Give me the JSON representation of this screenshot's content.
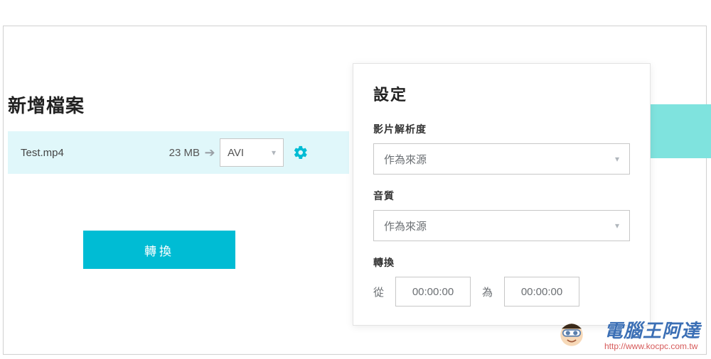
{
  "page": {
    "title": "新增檔案"
  },
  "file": {
    "name": "Test.mp4",
    "size": "23 MB",
    "format_selected": "AVI"
  },
  "actions": {
    "convert_label": "轉換"
  },
  "settings": {
    "title": "設定",
    "video_resolution": {
      "label": "影片解析度",
      "value": "作為來源"
    },
    "audio_quality": {
      "label": "音質",
      "value": "作為來源"
    },
    "trim": {
      "label": "轉換",
      "from_label": "從",
      "from_value": "00:00:00",
      "to_label": "為",
      "to_value": "00:00:00"
    }
  },
  "watermark": {
    "text": "電腦王阿達",
    "url": "http://www.kocpc.com.tw"
  },
  "colors": {
    "accent": "#00bcd4",
    "row_bg": "#e0f7fa",
    "strip": "#7fe3de"
  }
}
